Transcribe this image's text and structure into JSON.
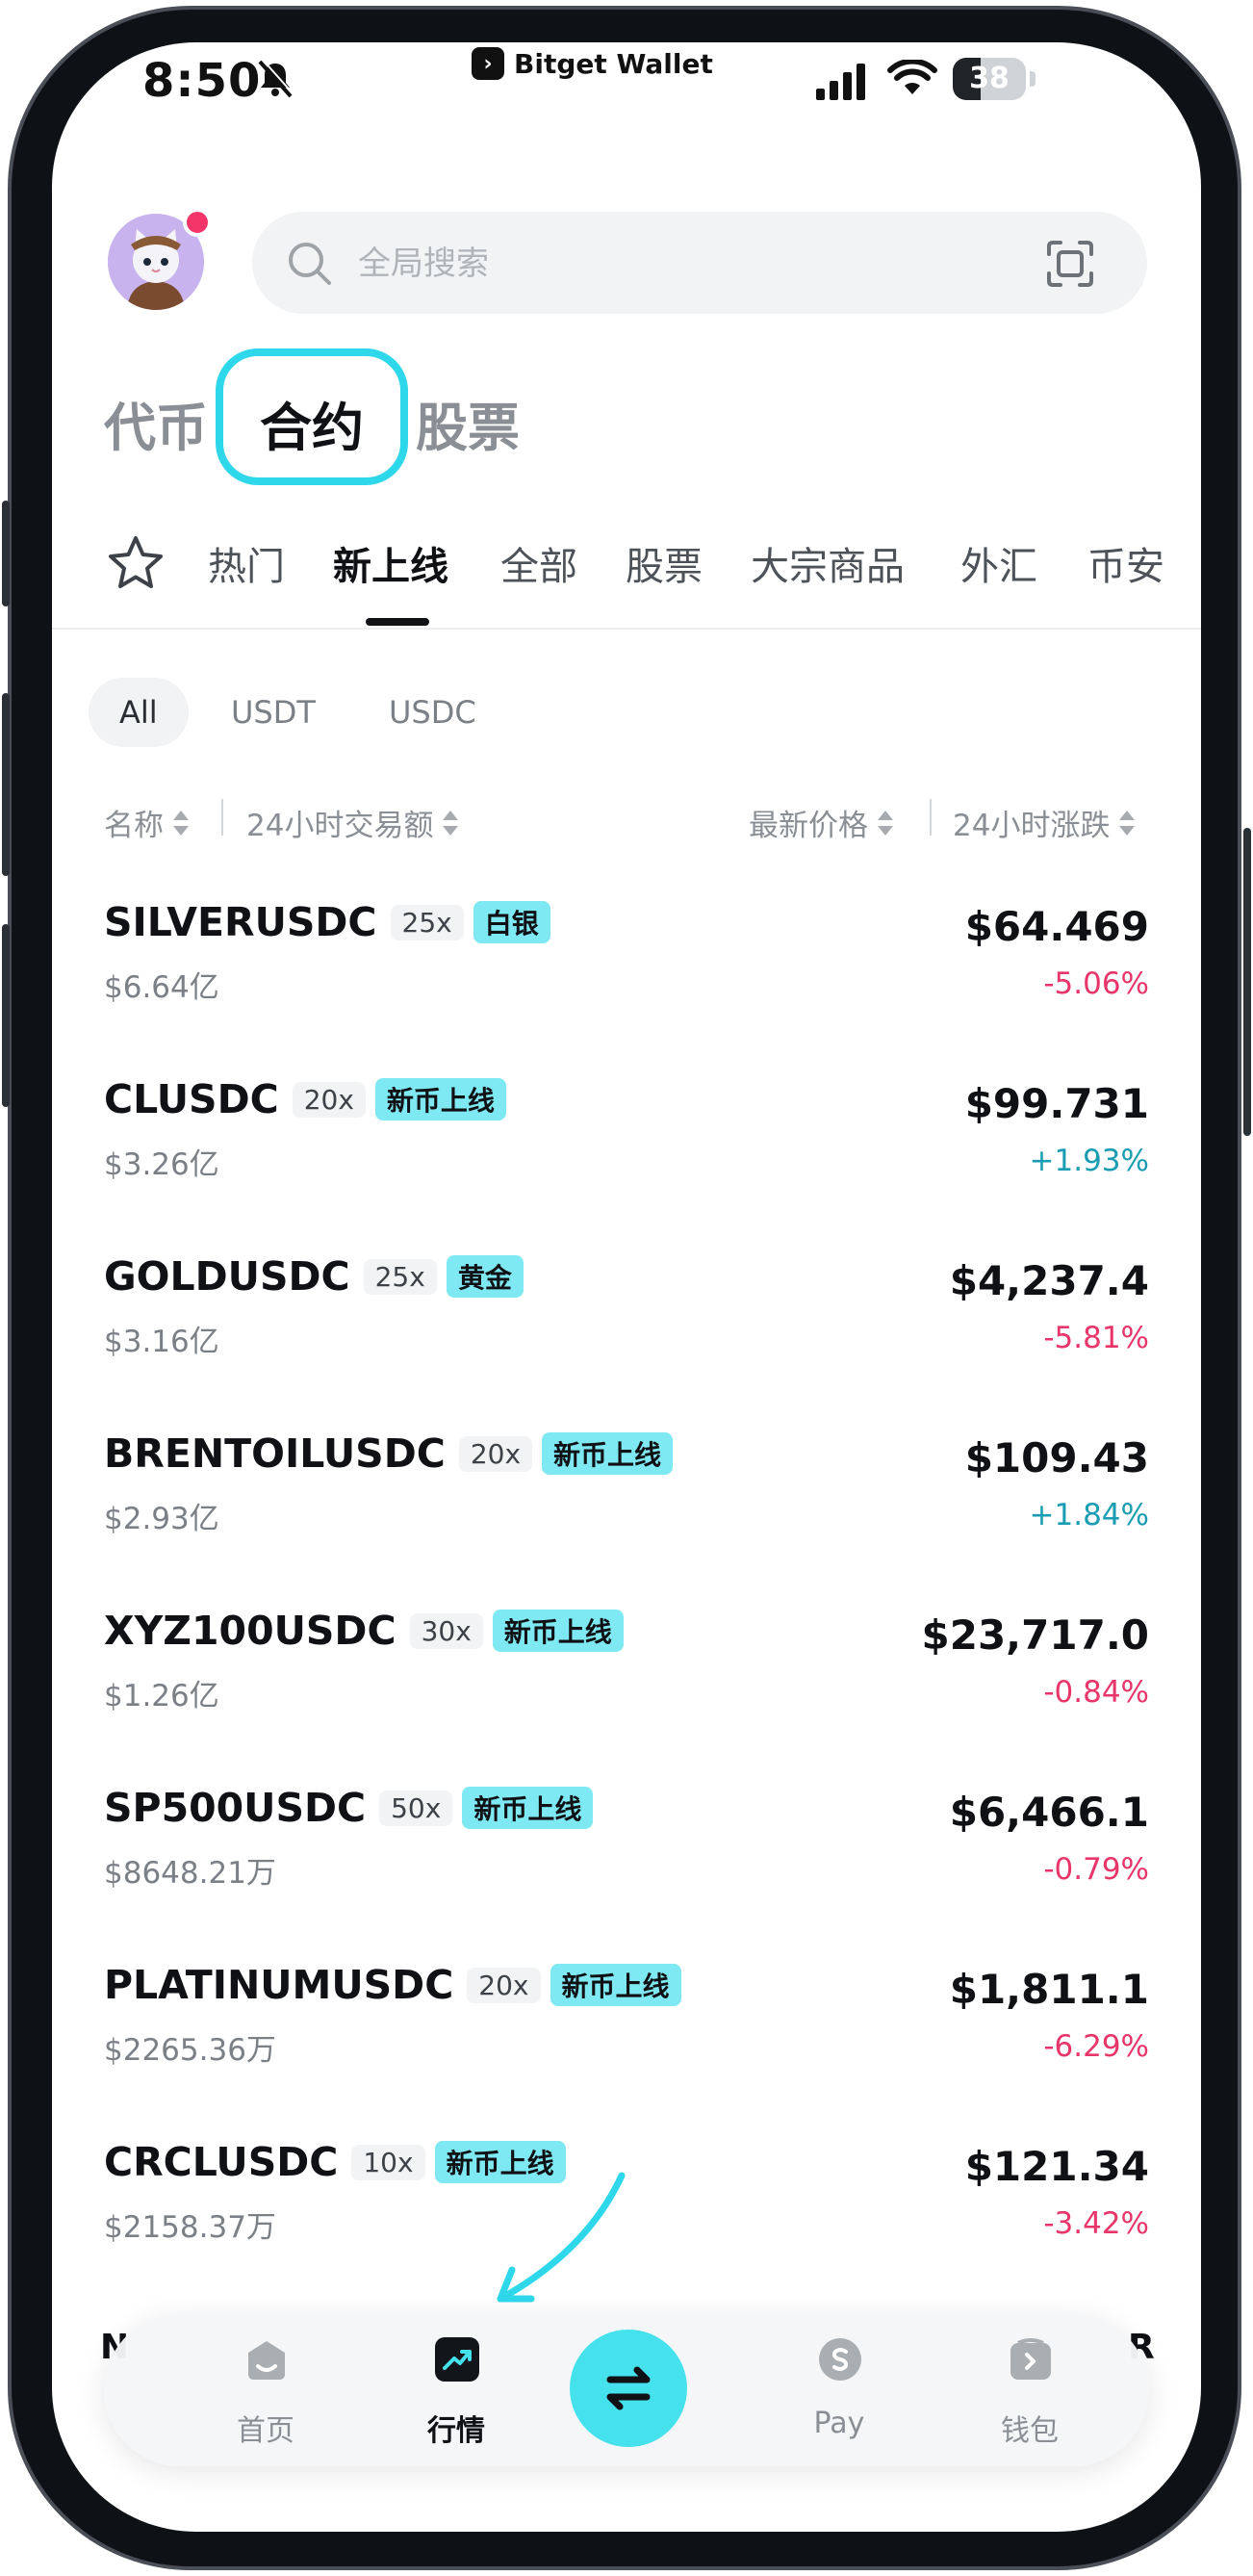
{
  "status_bar": {
    "time": "8:50",
    "brand": "Bitget Wallet",
    "battery": "38",
    "battery_level": 0.38
  },
  "header": {
    "search_placeholder": "全局搜索"
  },
  "top_tabs": [
    {
      "label": "代币",
      "active": false
    },
    {
      "label": "合约",
      "active": true
    },
    {
      "label": "股票",
      "active": false
    }
  ],
  "sub_tabs": [
    {
      "label": "热门"
    },
    {
      "label": "新上线",
      "active": true
    },
    {
      "label": "全部"
    },
    {
      "label": "股票"
    },
    {
      "label": "大宗商品"
    },
    {
      "label": "外汇"
    },
    {
      "label": "币安"
    }
  ],
  "quote_chips": [
    {
      "label": "All",
      "active": true
    },
    {
      "label": "USDT"
    },
    {
      "label": "USDC"
    }
  ],
  "columns": {
    "name": "名称",
    "volume": "24小时交易额",
    "price": "最新价格",
    "change": "24小时涨跌"
  },
  "rows": [
    {
      "symbol": "SILVERUSDC",
      "leverage": "25x",
      "tag": "白银",
      "volume": "$6.64亿",
      "price": "$64.469",
      "change": "-5.06%",
      "direction": "neg"
    },
    {
      "symbol": "CLUSDC",
      "leverage": "20x",
      "tag": "新币上线",
      "volume": "$3.26亿",
      "price": "$99.731",
      "change": "+1.93%",
      "direction": "pos"
    },
    {
      "symbol": "GOLDUSDC",
      "leverage": "25x",
      "tag": "黄金",
      "volume": "$3.16亿",
      "price": "$4,237.4",
      "change": "-5.81%",
      "direction": "neg"
    },
    {
      "symbol": "BRENTOILUSDC",
      "leverage": "20x",
      "tag": "新币上线",
      "volume": "$2.93亿",
      "price": "$109.43",
      "change": "+1.84%",
      "direction": "pos"
    },
    {
      "symbol": "XYZ100USDC",
      "leverage": "30x",
      "tag": "新币上线",
      "volume": "$1.26亿",
      "price": "$23,717.0",
      "change": "-0.84%",
      "direction": "neg"
    },
    {
      "symbol": "SP500USDC",
      "leverage": "50x",
      "tag": "新币上线",
      "volume": "$8648.21万",
      "price": "$6,466.1",
      "change": "-0.79%",
      "direction": "neg"
    },
    {
      "symbol": "PLATINUMUSDC",
      "leverage": "20x",
      "tag": "新币上线",
      "volume": "$2265.36万",
      "price": "$1,811.1",
      "change": "-6.29%",
      "direction": "neg"
    },
    {
      "symbol": "CRCLUSDC",
      "leverage": "10x",
      "tag": "新币上线",
      "volume": "$2158.37万",
      "price": "$121.34",
      "change": "-3.42%",
      "direction": "neg"
    }
  ],
  "bottom_nav": {
    "peek_left": "N",
    "peek_right": "R",
    "items": [
      {
        "label": "首页",
        "icon": "home-icon"
      },
      {
        "label": "行情",
        "icon": "market-chart-icon",
        "active": true
      },
      {
        "label": "",
        "icon": "swap-icon"
      },
      {
        "label": "Pay",
        "icon": "pay-dollar-icon"
      },
      {
        "label": "钱包",
        "icon": "wallet-icon"
      }
    ]
  },
  "colors": {
    "accent_cyan": "#45e2ee",
    "tag_bg": "#7fe9f3",
    "negative": "#e8356a",
    "positive": "#1a9db2"
  }
}
